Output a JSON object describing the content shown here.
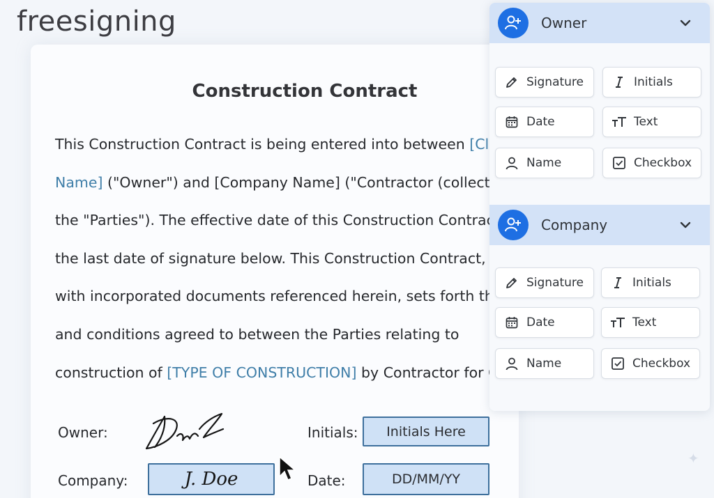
{
  "app": {
    "logo": "freesigning"
  },
  "document": {
    "title": "Construction Contract",
    "lines": [
      [
        {
          "t": "This Construction Contract is being entered into between "
        },
        {
          "t": "[Cli",
          "ph": true
        }
      ],
      [
        {
          "t": "Name]",
          "ph": true
        },
        {
          "t": " (\"Owner\") and [Company Name] (\"Contractor (collect"
        }
      ],
      [
        {
          "t": "the \"Parties\"). The effective date of this Construction Contract"
        }
      ],
      [
        {
          "t": "the last date of signature below. This Construction Contract, c"
        }
      ],
      [
        {
          "t": "with incorporated documents referenced herein, sets forth th"
        }
      ],
      [
        {
          "t": "and conditions agreed to between the Parties relating to"
        }
      ],
      [
        {
          "t": "construction of "
        },
        {
          "t": "[TYPE OF CONSTRUCTION]",
          "ph": true
        },
        {
          "t": " by Contractor for Ow"
        }
      ]
    ],
    "placeholder_color": "#3f7ea8",
    "signatures": {
      "owner_label": "Owner:",
      "company_label": "Company:",
      "company_signature": "J. Doe",
      "initials_label": "Initials:",
      "initials_value": "Initials Here",
      "date_label": "Date:",
      "date_value": "DD/MM/YY"
    }
  },
  "panel": {
    "roles": [
      {
        "label": "Owner",
        "tools": [
          {
            "label": "Signature",
            "icon": "pen-icon"
          },
          {
            "label": "Initials",
            "icon": "italic-icon"
          },
          {
            "label": "Date",
            "icon": "calendar-icon"
          },
          {
            "label": "Text",
            "icon": "text-size-icon"
          },
          {
            "label": "Name",
            "icon": "person-icon"
          },
          {
            "label": "Checkbox",
            "icon": "checkbox-icon"
          }
        ]
      },
      {
        "label": "Company",
        "tools": [
          {
            "label": "Signature",
            "icon": "pen-icon"
          },
          {
            "label": "Initials",
            "icon": "italic-icon"
          },
          {
            "label": "Date",
            "icon": "calendar-icon"
          },
          {
            "label": "Text",
            "icon": "text-size-icon"
          },
          {
            "label": "Name",
            "icon": "person-icon"
          },
          {
            "label": "Checkbox",
            "icon": "checkbox-icon"
          }
        ]
      }
    ],
    "accent": "#1e6fe3",
    "header_bg": "#d3e2f7"
  }
}
